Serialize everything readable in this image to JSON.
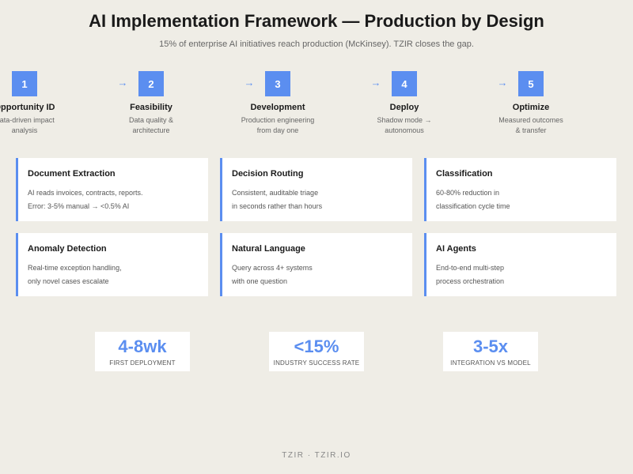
{
  "header": {
    "title": "AI Implementation Framework — Production by Design",
    "subtitle": "15% of enterprise AI initiatives reach production (McKinsey). TZIR closes the gap."
  },
  "steps": [
    {
      "num": "1",
      "label": "Opportunity ID",
      "desc1": "Data-driven impact",
      "desc2": "analysis"
    },
    {
      "num": "2",
      "label": "Feasibility",
      "desc1": "Data quality &",
      "desc2": "architecture"
    },
    {
      "num": "3",
      "label": "Development",
      "desc1": "Production engineering",
      "desc2": "from day one"
    },
    {
      "num": "4",
      "label": "Deploy",
      "desc1": "Shadow mode →",
      "desc2": "autonomous"
    },
    {
      "num": "5",
      "label": "Optimize",
      "desc1": "Measured outcomes",
      "desc2": "& transfer"
    }
  ],
  "arrow_glyph": "→",
  "cards": [
    {
      "title": "Document Extraction",
      "line1": "AI reads invoices, contracts, reports.",
      "line2": "Error: 3-5% manual → <0.5% AI"
    },
    {
      "title": "Decision Routing",
      "line1": "Consistent, auditable triage",
      "line2": "in seconds rather than hours"
    },
    {
      "title": "Classification",
      "line1": "60-80% reduction in",
      "line2": "classification cycle time"
    },
    {
      "title": "Anomaly Detection",
      "line1": "Real-time exception handling,",
      "line2": "only novel cases escalate"
    },
    {
      "title": "Natural Language",
      "line1": "Query across 4+ systems",
      "line2": "with one question"
    },
    {
      "title": "AI Agents",
      "line1": "End-to-end multi-step",
      "line2": "process orchestration"
    }
  ],
  "stats": [
    {
      "value": "4-8wk",
      "caption": "FIRST DEPLOYMENT"
    },
    {
      "value": "<15%",
      "caption": "INDUSTRY SUCCESS RATE"
    },
    {
      "value": "3-5x",
      "caption": "INTEGRATION VS MODEL"
    }
  ],
  "footer": "TZIR · TZIR.IO",
  "colors": {
    "accent": "#5b8ef0",
    "background": "#efede6",
    "card": "#ffffff"
  }
}
